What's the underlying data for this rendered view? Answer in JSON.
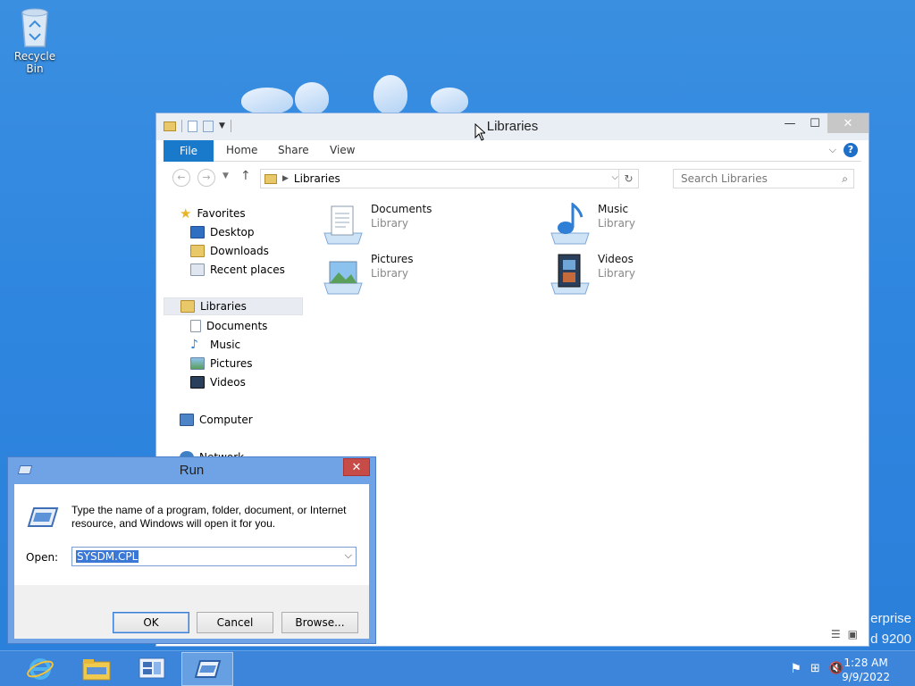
{
  "desktop": {
    "recycle_bin_label": "Recycle Bin",
    "watermark_line1": "erprise",
    "watermark_line2": "d 9200"
  },
  "explorer": {
    "title": "Libraries",
    "ribbon_tabs": {
      "file": "File",
      "home": "Home",
      "share": "Share",
      "view": "View"
    },
    "address": {
      "path": "Libraries"
    },
    "search_placeholder": "Search Libraries",
    "nav": {
      "favorites": "Favorites",
      "desktop": "Desktop",
      "downloads": "Downloads",
      "recent": "Recent places",
      "libraries": "Libraries",
      "documents": "Documents",
      "music": "Music",
      "pictures": "Pictures",
      "videos": "Videos",
      "computer": "Computer",
      "network": "Network"
    },
    "libraries": [
      {
        "name": "Documents",
        "type": "Library"
      },
      {
        "name": "Music",
        "type": "Library"
      },
      {
        "name": "Pictures",
        "type": "Library"
      },
      {
        "name": "Videos",
        "type": "Library"
      }
    ]
  },
  "run_dialog": {
    "title": "Run",
    "message": "Type the name of a program, folder, document, or Internet resource, and Windows will open it for you.",
    "open_label": "Open:",
    "open_value": "SYSDM.CPL",
    "ok_label": "OK",
    "cancel_label": "Cancel",
    "browse_label": "Browse..."
  },
  "taskbar": {
    "time": "1:28 AM",
    "date": "9/9/2022"
  },
  "colors": {
    "accent": "#1979ca",
    "desktop": "#2f86df",
    "taskbar": "#3c85da",
    "close_red": "#c74b46"
  }
}
